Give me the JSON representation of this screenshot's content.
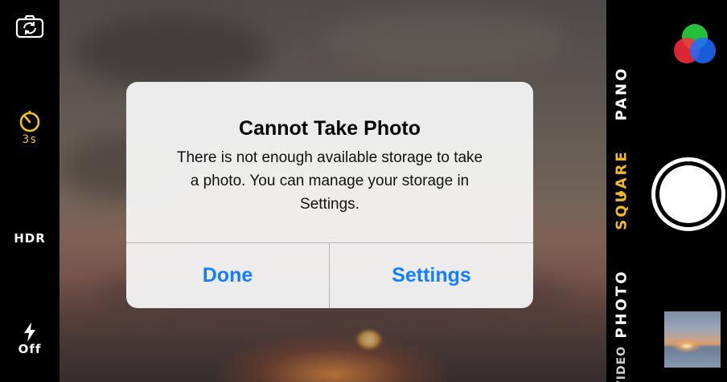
{
  "left_bar": {
    "flip_icon": "camera-flip-icon",
    "timer": {
      "icon": "timer-icon",
      "label": "3s",
      "color": "#f2c025"
    },
    "hdr": {
      "label": "HDR"
    },
    "flash": {
      "icon": "flash-icon",
      "label": "Off"
    }
  },
  "alert": {
    "title": "Cannot Take Photo",
    "message": "There is not enough available storage to take a photo. You can manage your storage in Settings.",
    "buttons": {
      "done": "Done",
      "settings": "Settings"
    },
    "button_color": "#147efb"
  },
  "right_bar": {
    "filters_icon": "filters-icon",
    "modes": [
      {
        "label": "PANO",
        "active": false
      },
      {
        "label": "SQUARE",
        "active": true
      },
      {
        "label": "PHOTO",
        "active": false
      },
      {
        "label": "VIDEO",
        "active": false
      }
    ],
    "active_color": "#f2b82c",
    "shutter_icon": "shutter-button",
    "thumbnail": "last-photo-thumbnail"
  }
}
